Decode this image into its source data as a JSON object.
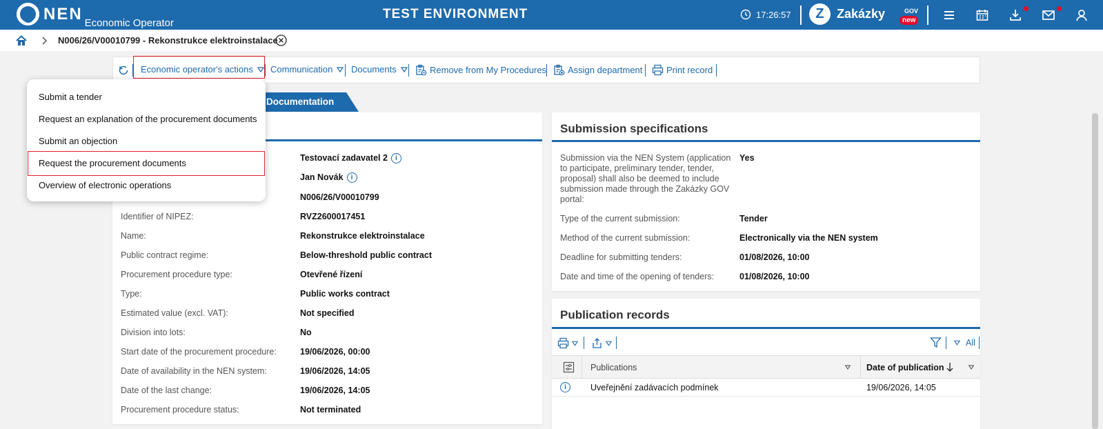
{
  "topbar": {
    "logo": "NEN",
    "logo_sub": "Economic Operator",
    "env_title": "TEST ENVIRONMENT",
    "clock": "17:26:57",
    "zakazky": "Zakázky",
    "zakazky_gov": "GOV",
    "zakazky_new": "new",
    "icons": [
      "menu-icon",
      "calendar-icon",
      "download-icon",
      "mail-icon",
      "user-icon"
    ]
  },
  "breadcrumb": {
    "title": "N006/26/V00010799 - Rekonstrukce elektroinstalace"
  },
  "toolbar": {
    "actions": "Economic operator's actions",
    "communication": "Communication",
    "documents": "Documents",
    "remove": "Remove from My Procedures",
    "assign": "Assign department",
    "print": "Print record"
  },
  "tabs": {
    "documentation": "Documentation"
  },
  "menu": {
    "items": [
      "Submit a tender",
      "Request an explanation of the procurement documents",
      "Submit an objection",
      "Request the procurement documents",
      "Overview of electronic operations"
    ]
  },
  "details": {
    "rows": [
      {
        "label": "",
        "value": "Testovací zadavatel 2"
      },
      {
        "label": "",
        "value": "Jan Novák"
      },
      {
        "label": "",
        "value": "N006/26/V00010799"
      },
      {
        "label": "Identifier of NIPEZ:",
        "value": "RVZ2600017451"
      },
      {
        "label": "Name:",
        "value": "Rekonstrukce elektroinstalace"
      },
      {
        "label": "Public contract regime:",
        "value": "Below-threshold public contract"
      },
      {
        "label": "Procurement procedure type:",
        "value": "Otevřené řízení"
      },
      {
        "label": "Type:",
        "value": "Public works contract"
      },
      {
        "label": "Estimated value (excl. VAT):",
        "value": "Not specified"
      },
      {
        "label": "Division into lots:",
        "value": "No"
      },
      {
        "label": "Start date of the procurement procedure:",
        "value": "19/06/2026, 00:00"
      },
      {
        "label": "Date of availability in the NEN system:",
        "value": "19/06/2026, 14:05"
      },
      {
        "label": "Date of the last change:",
        "value": "19/06/2026, 14:05"
      },
      {
        "label": "Procurement procedure status:",
        "value": "Not terminated"
      }
    ]
  },
  "submission": {
    "title": "Submission specifications",
    "rows": [
      {
        "label": "Submission via the NEN System (application to participate, preliminary tender, tender, proposal) shall also be deemed to include submission made through the Zakázky GOV portal:",
        "value": "Yes"
      },
      {
        "label": "Type of the current submission:",
        "value": "Tender"
      },
      {
        "label": "Method of the current submission:",
        "value": "Electronically via the NEN system"
      },
      {
        "label": "Deadline for submitting tenders:",
        "value": "01/08/2026, 10:00"
      },
      {
        "label": "Date and time of the opening of tenders:",
        "value": "01/08/2026, 10:00"
      }
    ]
  },
  "publications": {
    "title": "Publication records",
    "filter_all": "All",
    "col_publications": "Publications",
    "col_date": "Date of publication",
    "rows": [
      {
        "name": "Uveřejnění zadávacích podmínek",
        "date": "19/06/2026, 14:05"
      }
    ]
  },
  "colors": {
    "brand": "#1d6aad",
    "highlight": "#e01e2b",
    "badge": "#e30b28"
  }
}
